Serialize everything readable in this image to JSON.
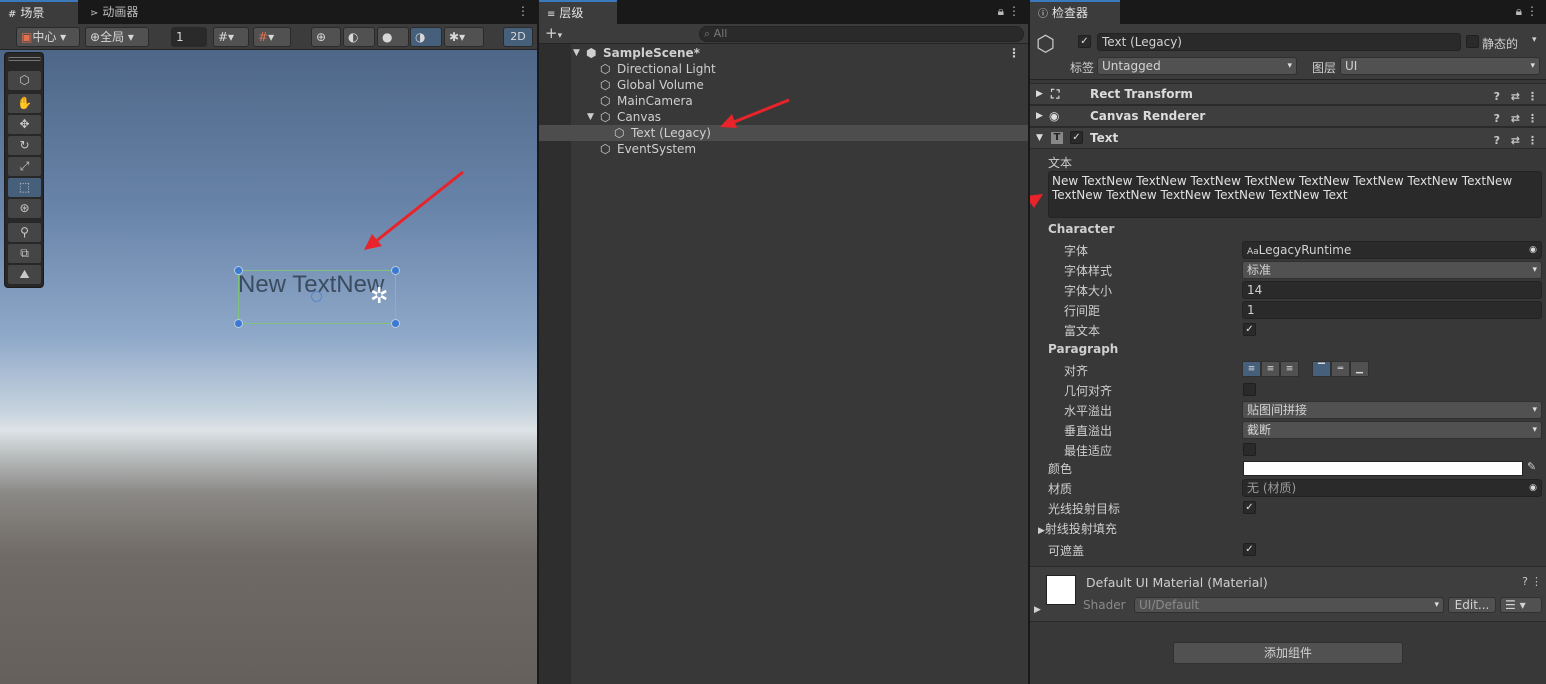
{
  "scene_panel": {
    "tabs": [
      {
        "label": "场景",
        "icon": "grid-icon"
      },
      {
        "label": "动画器",
        "icon": "animator-icon"
      }
    ],
    "pivot_mode": "中心",
    "space_mode": "全局",
    "grid_value": "1",
    "mode_2d": "2D"
  },
  "scene_view": {
    "text_object_label": "New TextNew"
  },
  "hierarchy": {
    "tab_label": "层级",
    "search_placeholder": "All",
    "scene_name": "SampleScene*",
    "items": [
      {
        "label": "Directional Light"
      },
      {
        "label": "Global Volume"
      },
      {
        "label": "MainCamera"
      },
      {
        "label": "Canvas"
      },
      {
        "label": "Text (Legacy)"
      },
      {
        "label": "EventSystem"
      }
    ]
  },
  "inspector": {
    "tab_label": "检查器",
    "object_name": "Text (Legacy)",
    "static_label": "静态的",
    "tag_label": "标签",
    "tag_value": "Untagged",
    "layer_label": "图层",
    "layer_value": "UI",
    "components": {
      "rect_transform": "Rect Transform",
      "canvas_renderer": "Canvas Renderer",
      "text": "Text"
    },
    "text_label": "文本",
    "text_value": "New TextNew TextNew TextNew TextNew TextNew TextNew TextNew TextNew TextNew TextNew TextNew TextNew TextNew Text",
    "character_header": "Character",
    "font_label": "字体",
    "font_value": "LegacyRuntime",
    "font_style_label": "字体样式",
    "font_style_value": "标准",
    "font_size_label": "字体大小",
    "font_size_value": "14",
    "line_spacing_label": "行间距",
    "line_spacing_value": "1",
    "rich_text_label": "富文本",
    "paragraph_header": "Paragraph",
    "alignment_label": "对齐",
    "align_by_geometry_label": "几何对齐",
    "horizontal_overflow_label": "水平溢出",
    "horizontal_overflow_value": "贴图间拼接",
    "vertical_overflow_label": "垂直溢出",
    "vertical_overflow_value": "截断",
    "best_fit_label": "最佳适应",
    "color_label": "颜色",
    "material_label": "材质",
    "material_value": "无 (材质)",
    "raycast_target_label": "光线投射目标",
    "raycast_padding_label": "射线投射填充",
    "maskable_label": "可遮盖",
    "material_asset_name": "Default UI Material (Material)",
    "shader_label": "Shader",
    "shader_value": "UI/Default",
    "edit_button": "Edit...",
    "add_component_button": "添加组件"
  },
  "colors": {
    "selection": "#46607c",
    "arrow": "#e8232a"
  }
}
